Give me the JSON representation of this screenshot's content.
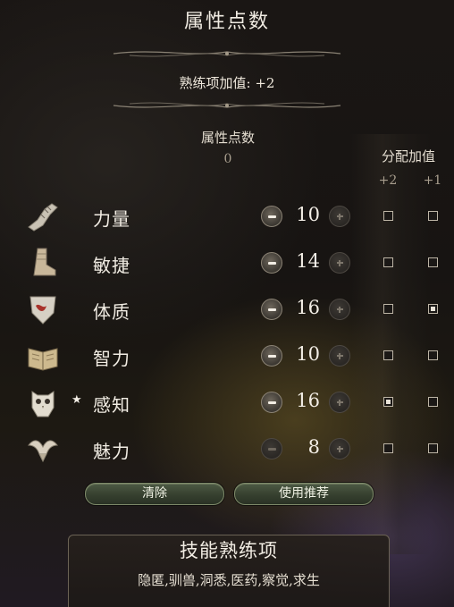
{
  "panel": {
    "title": "属性点数",
    "proficiency_bonus": "熟练项加值: +2"
  },
  "points": {
    "label": "属性点数",
    "value": "0"
  },
  "allocation": {
    "label": "分配加值",
    "plus2_label": "+2",
    "plus1_label": "+1"
  },
  "attributes": [
    {
      "name": "力量",
      "icon": "gauntlet-icon",
      "value": "10",
      "star": "",
      "minus_enabled": true,
      "plus2_checked": false,
      "plus1_checked": false
    },
    {
      "name": "敏捷",
      "icon": "boot-icon",
      "value": "14",
      "star": "",
      "minus_enabled": true,
      "plus2_checked": false,
      "plus1_checked": false
    },
    {
      "name": "体质",
      "icon": "shield-icon",
      "value": "16",
      "star": "",
      "minus_enabled": true,
      "plus2_checked": false,
      "plus1_checked": true
    },
    {
      "name": "智力",
      "icon": "book-icon",
      "value": "10",
      "star": "",
      "minus_enabled": true,
      "plus2_checked": false,
      "plus1_checked": false
    },
    {
      "name": "感知",
      "icon": "owl-icon",
      "value": "16",
      "star": "★",
      "minus_enabled": true,
      "plus2_checked": true,
      "plus1_checked": false
    },
    {
      "name": "魅力",
      "icon": "bird-icon",
      "value": "8",
      "star": "",
      "minus_enabled": false,
      "plus2_checked": false,
      "plus1_checked": false
    }
  ],
  "buttons": {
    "clear_label": "清除",
    "recommend_label": "使用推荐"
  },
  "skills": {
    "title": "技能熟练项",
    "list": "隐匿,驯兽,洞悉,医药,察觉,求生"
  },
  "colors": {
    "text": "#f1ece3",
    "muted": "#a89e8e",
    "button_green": "#36402f",
    "button_border": "#7e8a69"
  }
}
